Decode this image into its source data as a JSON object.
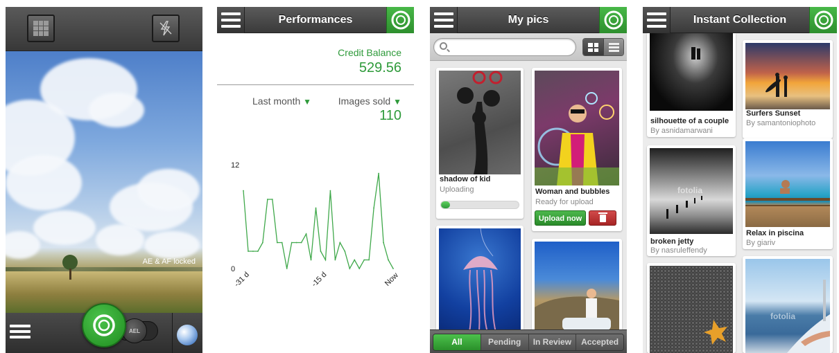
{
  "camera": {
    "lock_label": "AE & AF locked",
    "ael_label": "AEL",
    "icons": [
      "grid-icon",
      "flash-off-icon",
      "menu-icon",
      "shutter-icon",
      "globe-icon"
    ]
  },
  "performances": {
    "header_title": "Performances",
    "credit_label": "Credit Balance",
    "credit_value": "529.56",
    "period_filter": "Last month",
    "metric_filter": "Images sold",
    "metric_value": "110",
    "chart_data": {
      "type": "line",
      "title": "",
      "xlabel": "",
      "ylabel": "",
      "ylim": [
        0,
        12
      ],
      "y_ticks": [
        "12",
        "0"
      ],
      "x_tick_labels": [
        "-31 d",
        "-15 d",
        "Now"
      ],
      "x_tick_positions": [
        -31,
        -15,
        0
      ],
      "x": [
        -31,
        -30,
        -29,
        -28,
        -27,
        -26,
        -25,
        -24,
        -23,
        -22,
        -21,
        -20,
        -19,
        -18,
        -17,
        -16,
        -15,
        -14,
        -13,
        -12,
        -11,
        -10,
        -9,
        -8,
        -7,
        -6,
        -5,
        -4,
        -3,
        -2,
        -1,
        0
      ],
      "values": [
        9,
        2,
        2,
        2,
        3,
        8,
        8,
        3,
        3,
        0,
        3,
        3,
        3,
        4,
        1,
        7,
        2,
        1,
        9,
        1,
        3,
        2,
        0,
        1,
        0,
        1,
        1,
        7,
        11,
        3,
        1,
        0
      ],
      "line_color": "#3fa84a",
      "grid": false
    }
  },
  "mypics": {
    "header_title": "My pics",
    "search_placeholder": "",
    "cards": [
      {
        "title": "shadow of kid",
        "status": "Uploading",
        "progress": 0.12
      },
      {
        "title": "Woman and bubbles",
        "status": "Ready for upload",
        "upload_label": "Upload now"
      }
    ],
    "tabs": [
      "All",
      "Pending",
      "In Review",
      "Accepted"
    ],
    "active_tab": "All"
  },
  "collection": {
    "header_title": "Instant Collection",
    "watermark": "fotolia",
    "items": [
      {
        "title": "silhouette of a couple",
        "author": "By asnidamarwani"
      },
      {
        "title": "Surfers Sunset",
        "author": "By samantoniophoto"
      },
      {
        "title": "broken jetty",
        "author": "By nasruleffendy"
      },
      {
        "title": "Relax in piscina",
        "author": "By giariv"
      }
    ]
  },
  "colors": {
    "accent_green": "#2e9a3a",
    "header_dark": "#3a3a3a",
    "delete_red": "#b52b2b"
  }
}
